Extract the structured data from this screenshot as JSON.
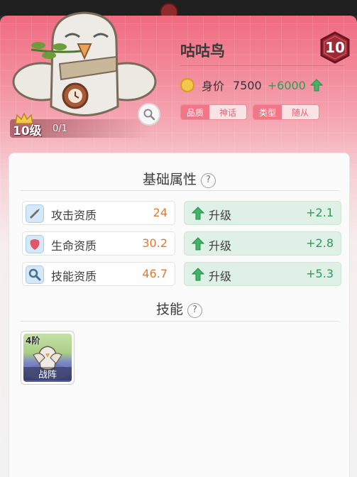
{
  "character": {
    "name": "咕咕鸟",
    "level_badge": "10",
    "level_text": "10级",
    "progress_text": "0/1",
    "worth_label": "身价",
    "worth_value": "7500",
    "worth_bonus": "+6000"
  },
  "tags": [
    {
      "key": "品质",
      "value": "神话"
    },
    {
      "key": "类型",
      "value": "随从"
    }
  ],
  "basic_attributes": {
    "title": "基础属性",
    "help": "?",
    "rows": [
      {
        "label": "攻击资质",
        "value": "24",
        "upgrade_label": "升级",
        "upgrade_value": "+2.1",
        "icon": "attack-icon"
      },
      {
        "label": "生命资质",
        "value": "30.2",
        "upgrade_label": "升级",
        "upgrade_value": "+2.8",
        "icon": "health-icon"
      },
      {
        "label": "技能资质",
        "value": "46.7",
        "upgrade_label": "升级",
        "upgrade_value": "+5.3",
        "icon": "skill-icon"
      }
    ]
  },
  "skills": {
    "title": "技能",
    "help": "?",
    "items": [
      {
        "tier": "4阶",
        "name": "战阵"
      }
    ]
  },
  "colors": {
    "accent_red": "#f06a80",
    "value_orange": "#e07a2e",
    "upgrade_green": "#2f9a55"
  }
}
